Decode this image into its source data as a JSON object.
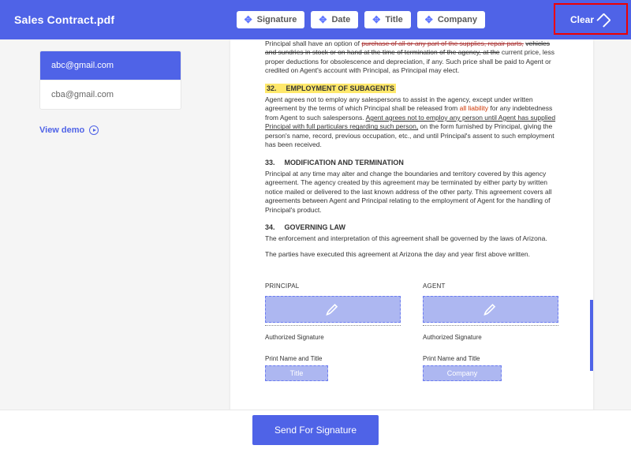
{
  "header": {
    "title": "Sales Contract.pdf",
    "buttons": {
      "signature": "Signature",
      "date": "Date",
      "title": "Title",
      "company": "Company"
    },
    "clear": "Clear"
  },
  "sidebar": {
    "emails": [
      {
        "address": "abc@gmail.com",
        "selected": true
      },
      {
        "address": "cba@gmail.com",
        "selected": false
      }
    ],
    "view_demo": "View demo"
  },
  "document": {
    "intro_para": "Principal shall have an option of purchase of all or any part of the supplies, repair parts, vehicles and sundries in stock or on hand at the time of termination of the agency, at the current price, less proper deductions for obsolescence and depreciation, if any. Such price shall be paid to Agent or credited on Agent's account with Principal, as Principal may elect.",
    "sec32_num": "32.",
    "sec32_title": "EMPLOYMENT OF SUBAGENTS",
    "sec32_body_a": "Agent agrees not to employ any salespersons to assist in the agency, except under written agreement by the terms of which Principal shall be released from ",
    "sec32_body_red": "all liability",
    "sec32_body_b": " for any indebtedness from Agent to such salespersons. ",
    "sec32_body_ul": "Agent agrees not to employ any person until Agent has supplied Principal with full particulars regarding such person,",
    "sec32_body_c": " on the form furnished by Principal, giving the person's name, record, previous occupation, etc., and until Principal's assent to such employment has been received.",
    "sec33_num": "33.",
    "sec33_title": "MODIFICATION AND TERMINATION",
    "sec33_body": "Principal at any time may alter and change the boundaries and territory covered by this agency agreement. The agency created by this agreement may be terminated by either party by written notice mailed or delivered to the last known address of the other party. This agreement covers all agreements between Agent and Principal relating to the employment of Agent for the handling of Principal's product.",
    "sec34_num": "34.",
    "sec34_title": "GOVERNING LAW",
    "sec34_body1": "The enforcement and interpretation of this agreement shall be governed by the laws of Arizona.",
    "sec34_body2": "The parties have executed this agreement at Arizona the day and year first above written.",
    "sig": {
      "principal": "PRINCIPAL",
      "agent": "AGENT",
      "auth": "Authorized Signature",
      "print": "Print Name and Title",
      "field_title": "Title",
      "field_company": "Company"
    }
  },
  "footer": {
    "send": "Send For Signature"
  }
}
